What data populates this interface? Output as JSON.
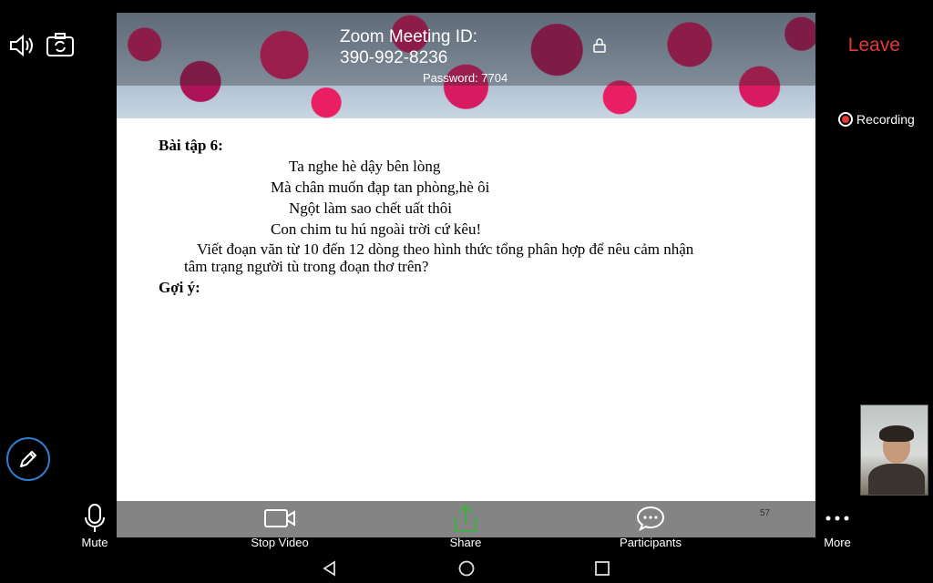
{
  "header": {
    "meeting_id_label": "Zoom Meeting ID:",
    "meeting_id": "390-992-8236",
    "password": "Password: 7704",
    "leave_label": "Leave",
    "icons": [
      "speaker-icon",
      "camera-switch-icon",
      "lock-icon"
    ]
  },
  "slide": {
    "exercise_title": "Bài tập 6:",
    "poem": [
      "Ta nghe hè dậy bên lòng",
      "Mà chân muốn đạp tan phòng,hè ôi",
      "Ngột làm sao chết uất thôi",
      "Con chim tu hú ngoài trời cứ kêu!"
    ],
    "task_line1": "Viết đoạn văn từ 10 đến 12 dòng theo hình thức tổng phân hợp để nêu cảm nhận",
    "task_line2": "tâm trạng người tù trong đoạn thơ trên?",
    "hint": "Gợi ý:",
    "page_number": "57"
  },
  "recording": {
    "label": "Recording",
    "color": "#e53935"
  },
  "toolbar": {
    "mute": "Mute",
    "stop_video": "Stop Video",
    "share": "Share",
    "participants": "Participants",
    "more": "More",
    "share_color": "#3cb043"
  },
  "colors": {
    "leave": "#e53935",
    "pencil_ring": "#2e7dd1"
  }
}
